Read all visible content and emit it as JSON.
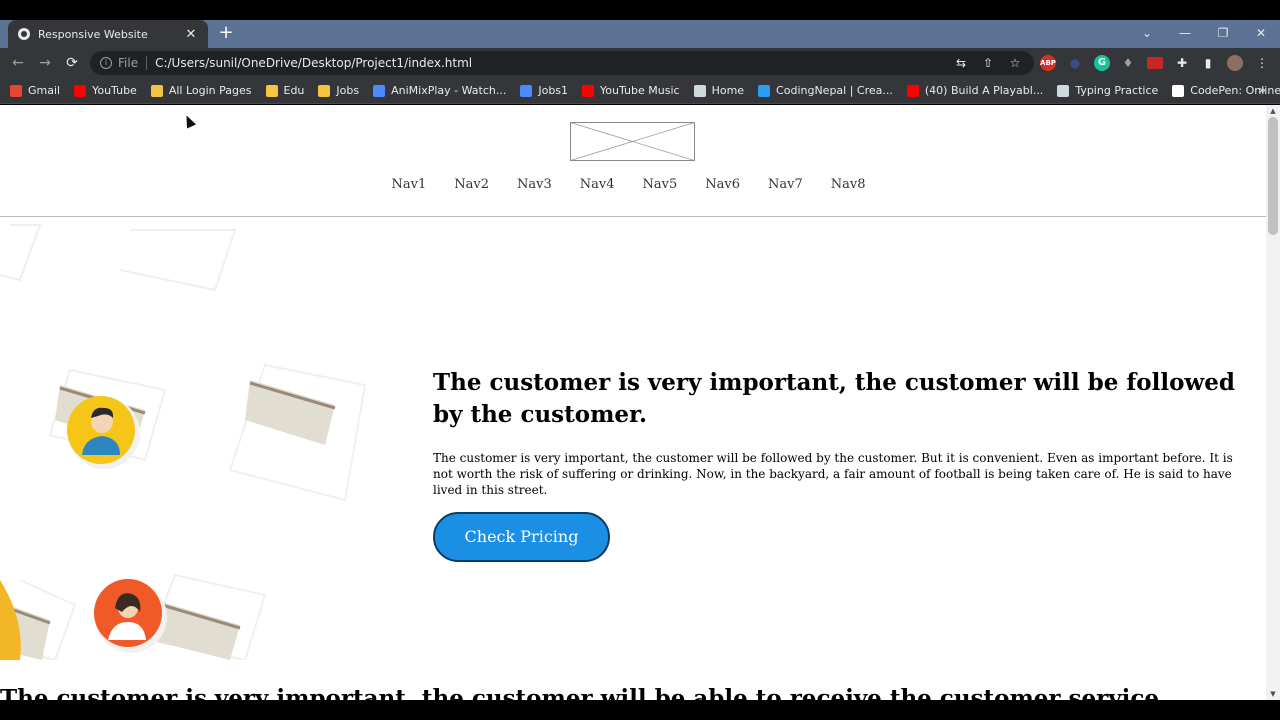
{
  "browser": {
    "tab_title": "Responsive Website",
    "tab_close": "✕",
    "new_tab": "+",
    "controls": {
      "menu": "⌄",
      "minimize": "—",
      "restore": "❐",
      "close": "✕"
    },
    "omnibox": {
      "scheme_label": "File",
      "url": "C:/Users/sunil/OneDrive/Desktop/Project1/index.html"
    },
    "bookmarks": [
      {
        "label": "Gmail",
        "color": "#ea4335"
      },
      {
        "label": "YouTube",
        "color": "#ff0000"
      },
      {
        "label": "All Login Pages",
        "color": "#f4c542"
      },
      {
        "label": "Edu",
        "color": "#f4c542"
      },
      {
        "label": "Jobs",
        "color": "#f4c542"
      },
      {
        "label": "AniMixPlay - Watch...",
        "color": "#4a8cff"
      },
      {
        "label": "Jobs1",
        "color": "#4a8cff"
      },
      {
        "label": "YouTube Music",
        "color": "#ff0000"
      },
      {
        "label": "Home",
        "color": "#cfd8dc"
      },
      {
        "label": "CodingNepal | Crea...",
        "color": "#2a9df4"
      },
      {
        "label": "(40) Build A Playabl...",
        "color": "#ff0000"
      },
      {
        "label": "Typing Practice",
        "color": "#cfd8dc"
      },
      {
        "label": "CodePen: Online C...",
        "color": "#ffffff"
      }
    ],
    "bookmarks_more": "»",
    "extensions": {
      "abp": "ABP",
      "grammarly": "G"
    }
  },
  "page": {
    "nav": [
      "Nav1",
      "Nav2",
      "Nav3",
      "Nav4",
      "Nav5",
      "Nav6",
      "Nav7",
      "Nav8"
    ],
    "hero": {
      "title": "The customer is very important, the customer will be followed by the customer.",
      "body": "The customer is very important, the customer will be followed by the customer. But it is convenient. Even as important before. It is not worth the risk of suffering or drinking. Now, in the backyard, a fair amount of football is being taken care of. He is said to have lived in this street.",
      "cta_label": "Check Pricing"
    },
    "next_section_title": "The customer is very important, the customer will be able to receive the customer service",
    "colors": {
      "cta": "#1a8fe3",
      "avatar_yellow": "#f5c518",
      "avatar_orange": "#f05a28"
    }
  }
}
